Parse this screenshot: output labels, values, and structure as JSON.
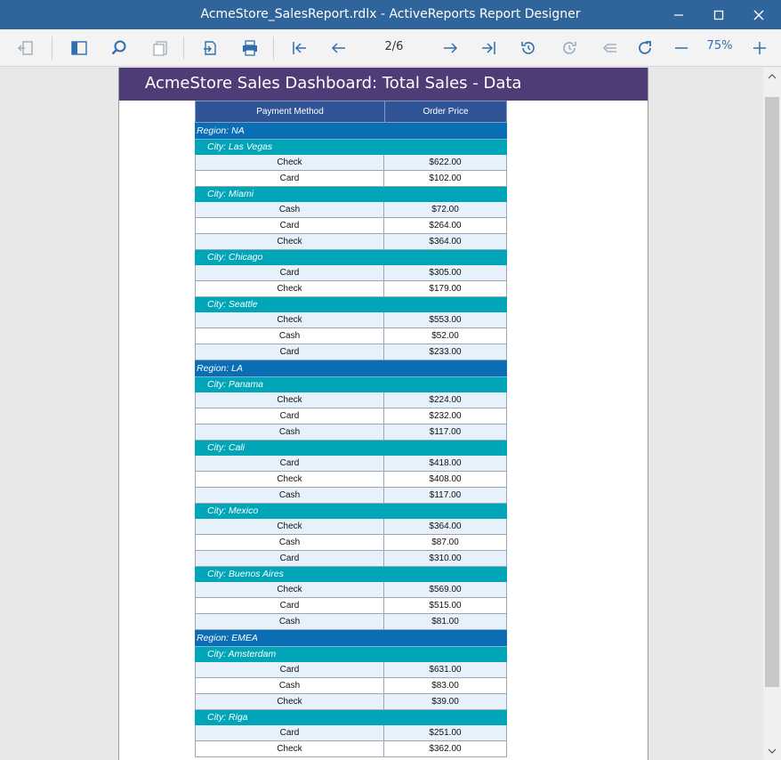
{
  "window": {
    "title": "AcmeStore_SalesReport.rdlx - ActiveReports Report Designer"
  },
  "toolbar": {
    "page": "2/6",
    "zoom": "75%"
  },
  "icons": [
    "back-icon",
    "sidebar-toggle-icon",
    "search-icon",
    "pages-icon",
    "export-icon",
    "print-icon",
    "first-page-icon",
    "previous-page-icon",
    "next-page-icon",
    "last-page-icon",
    "history-back-icon",
    "history-forward-icon",
    "parent-report-icon",
    "refresh-icon",
    "zoom-out-icon",
    "zoom-in-icon"
  ],
  "report": {
    "title": "AcmeStore Sales Dashboard: Total Sales - Data",
    "columns": [
      "Payment Method",
      "Order Price"
    ],
    "regions": [
      {
        "label": "Region: NA",
        "cities": [
          {
            "label": "City: Las Vegas",
            "rows": [
              [
                "Check",
                "$622.00"
              ],
              [
                "Card",
                "$102.00"
              ]
            ]
          },
          {
            "label": "City: Miami",
            "rows": [
              [
                "Cash",
                "$72.00"
              ],
              [
                "Card",
                "$264.00"
              ],
              [
                "Check",
                "$364.00"
              ]
            ]
          },
          {
            "label": "City: Chicago",
            "rows": [
              [
                "Card",
                "$305.00"
              ],
              [
                "Check",
                "$179.00"
              ]
            ]
          },
          {
            "label": "City: Seattle",
            "rows": [
              [
                "Check",
                "$553.00"
              ],
              [
                "Cash",
                "$52.00"
              ],
              [
                "Card",
                "$233.00"
              ]
            ]
          }
        ]
      },
      {
        "label": "Region: LA",
        "cities": [
          {
            "label": "City: Panama",
            "rows": [
              [
                "Check",
                "$224.00"
              ],
              [
                "Card",
                "$232.00"
              ],
              [
                "Cash",
                "$117.00"
              ]
            ]
          },
          {
            "label": "City: Cali",
            "rows": [
              [
                "Card",
                "$418.00"
              ],
              [
                "Check",
                "$408.00"
              ],
              [
                "Cash",
                "$117.00"
              ]
            ]
          },
          {
            "label": "City: Mexico",
            "rows": [
              [
                "Check",
                "$364.00"
              ],
              [
                "Cash",
                "$87.00"
              ],
              [
                "Card",
                "$310.00"
              ]
            ]
          },
          {
            "label": "City: Buenos Aires",
            "rows": [
              [
                "Check",
                "$569.00"
              ],
              [
                "Card",
                "$515.00"
              ],
              [
                "Cash",
                "$81.00"
              ]
            ]
          }
        ]
      },
      {
        "label": "Region: EMEA",
        "cities": [
          {
            "label": "City: Amsterdam",
            "rows": [
              [
                "Card",
                "$631.00"
              ],
              [
                "Cash",
                "$83.00"
              ],
              [
                "Check",
                "$39.00"
              ]
            ]
          },
          {
            "label": "City: Riga",
            "rows": [
              [
                "Card",
                "$251.00"
              ],
              [
                "Check",
                "$362.00"
              ]
            ]
          }
        ]
      }
    ]
  }
}
